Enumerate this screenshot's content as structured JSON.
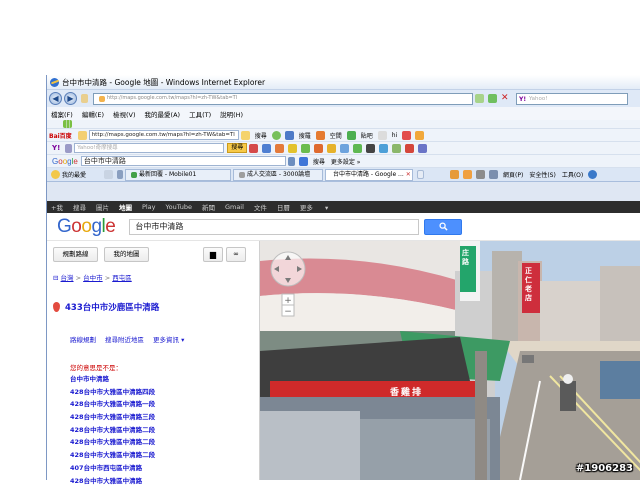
{
  "window": {
    "title": "台中市中清路 - Google 地圖 - Windows Internet Explorer"
  },
  "address_bar": {
    "url": "http://maps.google.com.tw/maps?hl=zh-TW&tab=Tl",
    "search_placeholder": "Yahoo!"
  },
  "menu": [
    "檔案(F)",
    "編輯(E)",
    "檢視(V)",
    "我的最愛(A)",
    "工具(T)",
    "說明(H)"
  ],
  "baidu_toolbar": {
    "url": "http://maps.google.com.tw/maps?hl=zh-TW&tab=Tl",
    "search_label": "搜尋",
    "items": [
      "搜羅",
      "空間",
      "貼吧",
      "hi"
    ]
  },
  "yahoo_toolbar": {
    "placeholder": "Yahoo!奇摩搜尋",
    "search_label": "搜尋"
  },
  "google_toolbar": {
    "query": "台中市中清路",
    "search_label": "搜尋",
    "more_settings": "更多設定 »"
  },
  "tabs_bar": {
    "favorites_label": "我的最愛",
    "tabs": [
      "最新回覆 - Mobile01",
      "成人交流區 - 3000論壇",
      "台中市中清路 - Google ..."
    ],
    "right_tools": [
      "網頁(P)",
      "安全性(S)",
      "工具(O)"
    ]
  },
  "google_bar": {
    "items": [
      "+我",
      "搜尋",
      "圖片",
      "地圖",
      "Play",
      "YouTube",
      "新聞",
      "Gmail",
      "文件",
      "日曆",
      "更多"
    ]
  },
  "google_header": {
    "logo": "Google",
    "query": "台中市中清路"
  },
  "left_panel": {
    "buttons": [
      "規劃路線",
      "我的地圖"
    ],
    "breadcrumb": [
      "台灣",
      "台中市",
      "西屯區"
    ],
    "place_title": "433台中市沙鹿區中清路",
    "actions": [
      "路線規劃",
      "搜尋附近地區",
      "更多資訊 ▾"
    ],
    "did_you_mean": "您的意思是不是：",
    "suggestions": [
      "台中市中清路",
      "428台中市大雅區中清路四段",
      "428台中市大雅區中清路一段",
      "428台中市大雅區中清路三段",
      "428台中市大雅區中清路二段",
      "428台中市大雅區中清路二段",
      "428台中市大雅區中清路二段",
      "407台中市西屯區中清路",
      "428台中市大雅區中清路"
    ]
  },
  "street_view": {
    "sign_street": "庄路",
    "shop_banner": "香雞排",
    "store_sign": "正仁老店"
  },
  "watermark": "#1906283",
  "colors": {
    "google_blue": "#4d90fe",
    "link_blue": "#1a1ad0",
    "red_text": "#cc0000",
    "ie_frame": "#dfe7f3"
  }
}
